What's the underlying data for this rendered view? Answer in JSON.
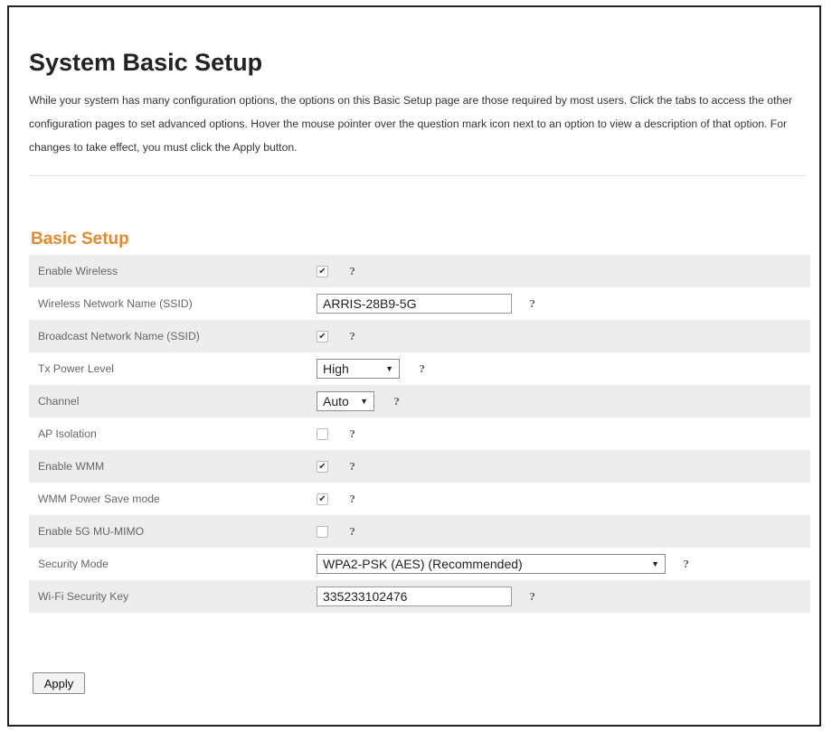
{
  "page": {
    "title": "System Basic Setup",
    "intro": "While your system has many configuration options, the options on this Basic Setup page are those required by most users. Click the tabs to access the other configuration pages to set advanced options. Hover the mouse pointer over the question mark icon next to an option to view a description of that option. For changes to take effect, you must click the Apply button."
  },
  "section": {
    "title": "Basic Setup"
  },
  "help_glyph": "?",
  "check_glyph": "✔",
  "dropdown_arrow": "▼",
  "rows": {
    "enable_wireless": {
      "label": "Enable Wireless",
      "checked": true
    },
    "ssid": {
      "label": "Wireless Network Name (SSID)",
      "value": "ARRIS-28B9-5G"
    },
    "broadcast_ssid": {
      "label": "Broadcast Network Name (SSID)",
      "checked": true
    },
    "tx_power": {
      "label": "Tx Power Level",
      "selected": "High"
    },
    "channel": {
      "label": "Channel",
      "selected": "Auto"
    },
    "ap_isolation": {
      "label": "AP Isolation",
      "checked": false
    },
    "enable_wmm": {
      "label": "Enable WMM",
      "checked": true
    },
    "wmm_power_save": {
      "label": "WMM Power Save mode",
      "checked": true
    },
    "enable_mu_mimo": {
      "label": "Enable 5G MU-MIMO",
      "checked": false
    },
    "security_mode": {
      "label": "Security Mode",
      "selected": "WPA2-PSK (AES) (Recommended)"
    },
    "security_key": {
      "label": "Wi-Fi Security Key",
      "value": "335233102476"
    }
  },
  "buttons": {
    "apply": "Apply"
  },
  "colors": {
    "accent": "#e8892b",
    "row_shade": "#ededed"
  }
}
